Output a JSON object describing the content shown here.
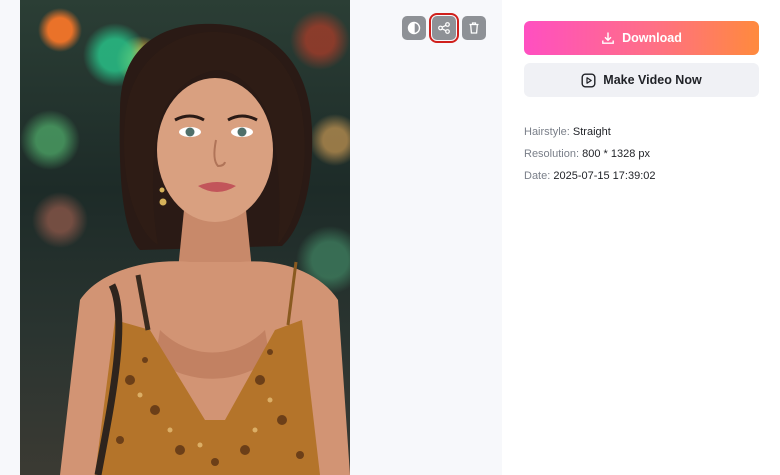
{
  "preview": {
    "image_alt": "Generated portrait of a woman with a straight bob hairstyle",
    "actions": [
      {
        "name": "compare",
        "icon": "compare-icon"
      },
      {
        "name": "share",
        "icon": "share-icon",
        "highlighted": true
      },
      {
        "name": "delete",
        "icon": "trash-icon"
      }
    ]
  },
  "panel": {
    "download_label": "Download",
    "video_label": "Make Video Now",
    "details": {
      "hairstyle_label": "Hairstyle:",
      "hairstyle_value": "Straight",
      "resolution_label": "Resolution:",
      "resolution_value": "800 * 1328 px",
      "date_label": "Date:",
      "date_value": "2025-07-15 17:39:02"
    }
  },
  "colors": {
    "download_gradient_start": "#ff4fc1",
    "download_gradient_end": "#ff8a3d",
    "highlight_outline": "#d0201c",
    "icon_button_bg": "#8e9196"
  }
}
